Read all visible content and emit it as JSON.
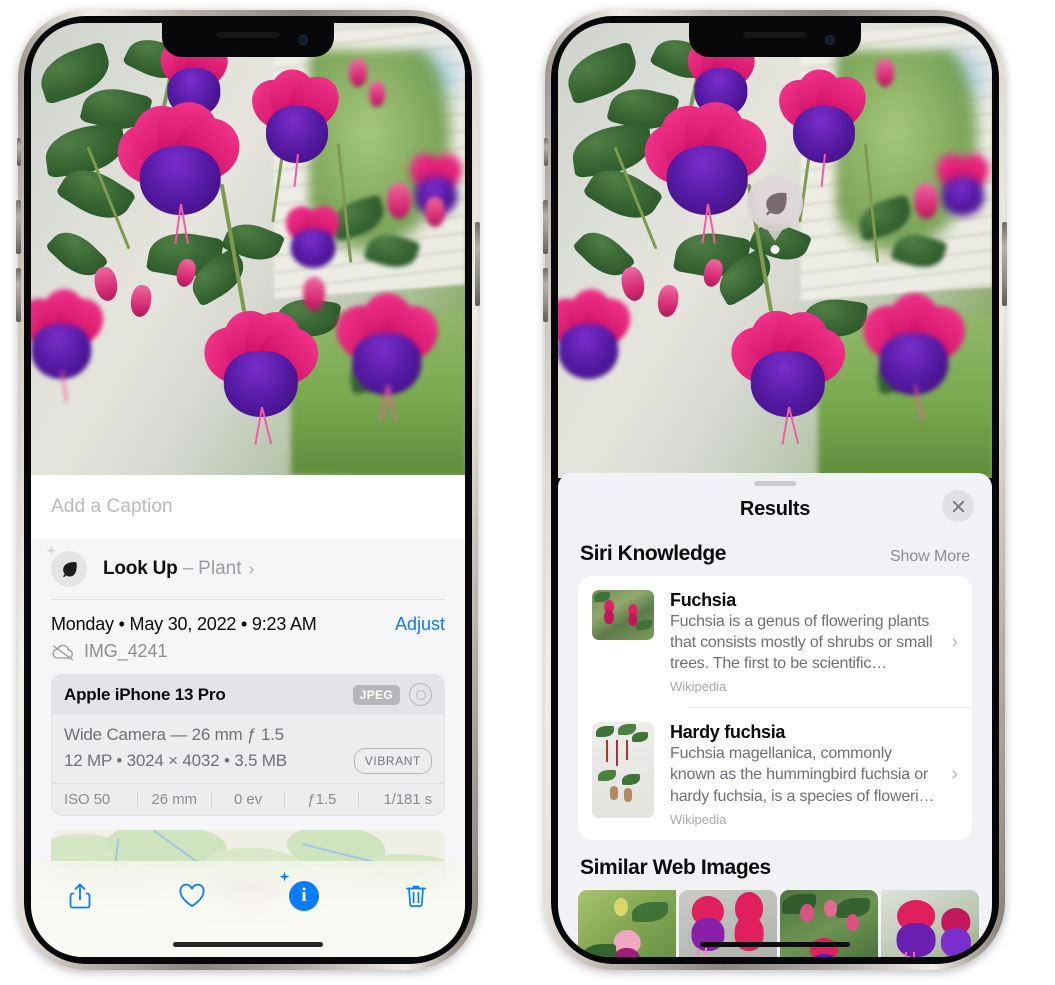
{
  "left_phone": {
    "caption": {
      "placeholder": "Add a Caption",
      "value": ""
    },
    "look_up": {
      "title": "Look Up",
      "dash": "–",
      "kind": "Plant",
      "chevron": "›",
      "icon": "leaf-icon"
    },
    "meta": {
      "date_line": "Monday • May 30, 2022 • 9:23 AM",
      "adjust_label": "Adjust",
      "file_name": "IMG_4241",
      "cloud_icon": "icloud-slash-icon"
    },
    "camera_card": {
      "model": "Apple iPhone 13 Pro",
      "format_badge": "JPEG",
      "aperture_icon": "aperture-icon",
      "lens_line": "Wide Camera — 26 mm ƒ 1.5",
      "size_line": "12 MP • 3024 × 4032 • 3.5 MB",
      "style_badge": "VIBRANT",
      "exif": [
        "ISO 50",
        "26 mm",
        "0 ev",
        "ƒ1.5",
        "1/181 s"
      ]
    },
    "map": {
      "pin_label": "photo-pin"
    },
    "toolbar": [
      {
        "name": "share-button",
        "icon": "share-icon"
      },
      {
        "name": "favorite-button",
        "icon": "heart-icon"
      },
      {
        "name": "info-button",
        "icon": "info-sparkle-icon"
      },
      {
        "name": "delete-button",
        "icon": "trash-icon"
      }
    ]
  },
  "right_phone": {
    "visual_lookup_badge": {
      "icon": "leaf-icon"
    },
    "sheet": {
      "title": "Results",
      "close_label": "✕",
      "sections": [
        {
          "title": "Siri Knowledge",
          "action": "Show More",
          "items": [
            {
              "title": "Fuchsia",
              "description": "Fuchsia is a genus of flowering plants that consists mostly of shrubs or small trees. The first to be scientific…",
              "source": "Wikipedia",
              "chevron": "›"
            },
            {
              "title": "Hardy fuchsia",
              "description": "Fuchsia magellanica, commonly known as the hummingbird fuchsia or hardy fuchsia, is a species of floweri…",
              "source": "Wikipedia",
              "chevron": "›"
            }
          ]
        },
        {
          "title": "Similar Web Images",
          "action": "",
          "images": [
            "web-image-1",
            "web-image-2",
            "web-image-3",
            "web-image-4"
          ]
        }
      ]
    }
  },
  "colors": {
    "accent_blue": "#0a7cff",
    "sheet_bg": "#f2f1f6",
    "card_bg": "#ffffff",
    "secondary_text": "#8e8e93",
    "page_bg": "#ffffff"
  }
}
